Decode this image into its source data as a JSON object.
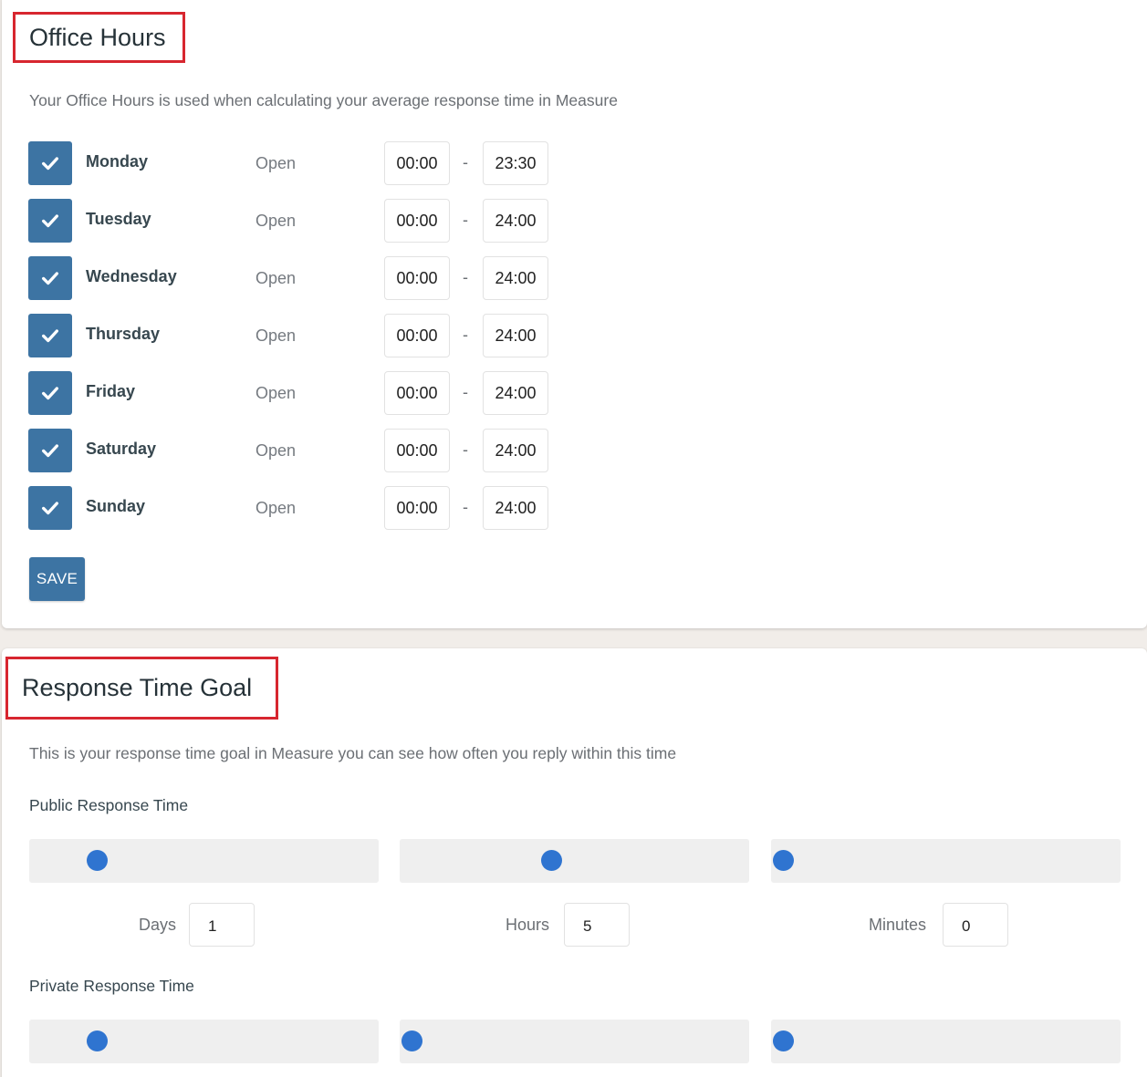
{
  "office_hours": {
    "title": "Office Hours",
    "description": "Your Office Hours is used when calculating your average response time in Measure",
    "days": [
      {
        "name": "Monday",
        "status": "Open",
        "open": "00:00",
        "close": "23:30",
        "checked": true
      },
      {
        "name": "Tuesday",
        "status": "Open",
        "open": "00:00",
        "close": "24:00",
        "checked": true
      },
      {
        "name": "Wednesday",
        "status": "Open",
        "open": "00:00",
        "close": "24:00",
        "checked": true
      },
      {
        "name": "Thursday",
        "status": "Open",
        "open": "00:00",
        "close": "24:00",
        "checked": true
      },
      {
        "name": "Friday",
        "status": "Open",
        "open": "00:00",
        "close": "24:00",
        "checked": true
      },
      {
        "name": "Saturday",
        "status": "Open",
        "open": "00:00",
        "close": "24:00",
        "checked": true
      },
      {
        "name": "Sunday",
        "status": "Open",
        "open": "00:00",
        "close": "24:00",
        "checked": true
      }
    ],
    "separator": "-",
    "save_label": "SAVE"
  },
  "response_goal": {
    "title": "Response Time Goal",
    "description": "This is your response time goal in Measure you can see how often you reply within this time",
    "public": {
      "label": "Public Response Time",
      "days_label": "Days",
      "days_value": "1",
      "hours_label": "Hours",
      "hours_value": "5",
      "minutes_label": "Minutes",
      "minutes_value": "0",
      "days_fraction": 0.17,
      "hours_fraction": 0.43,
      "minutes_fraction": 0.0
    },
    "private": {
      "label": "Private Response Time",
      "days_fraction": 0.17,
      "hours_fraction": 0.0,
      "minutes_fraction": 0.0
    }
  },
  "colors": {
    "accent": "#3d74a3",
    "slider_thumb": "#2f74d0",
    "highlight_border": "#d7262f"
  },
  "icons": {
    "checkbox": "check-icon"
  }
}
